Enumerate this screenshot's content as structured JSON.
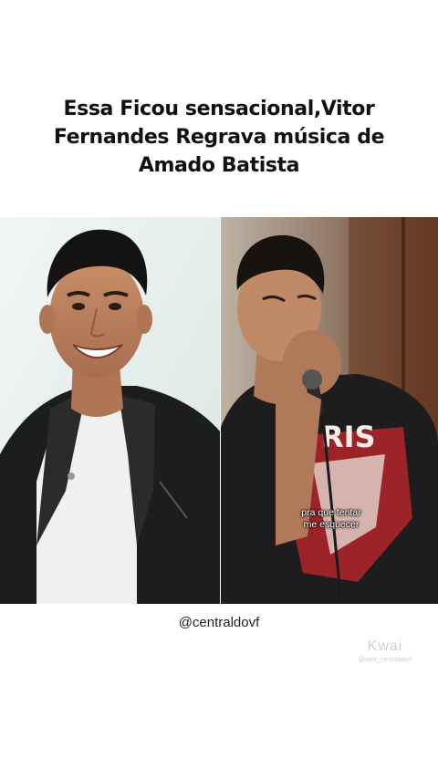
{
  "headline": {
    "line1": "Essa Ficou sensacional,Vitor",
    "line2": "Fernandes Regrava música de",
    "line3": "Amado Batista"
  },
  "left_photo": {
    "description_icon": "portrait-smiling-leather-jacket"
  },
  "right_photo": {
    "description_icon": "singer-with-microphone",
    "shirt_text": "RIS",
    "caption_line1": "pra que tentar",
    "caption_line2": "me esquecer"
  },
  "credit": {
    "handle": "@centraldovf"
  },
  "watermark": {
    "logo": "Kwai",
    "user": "@vitor_centraldovf"
  },
  "colors": {
    "background": "#ffffff",
    "headline": "#111111",
    "jacket": "#1c1e1d",
    "right_bg": "#3b3431"
  }
}
